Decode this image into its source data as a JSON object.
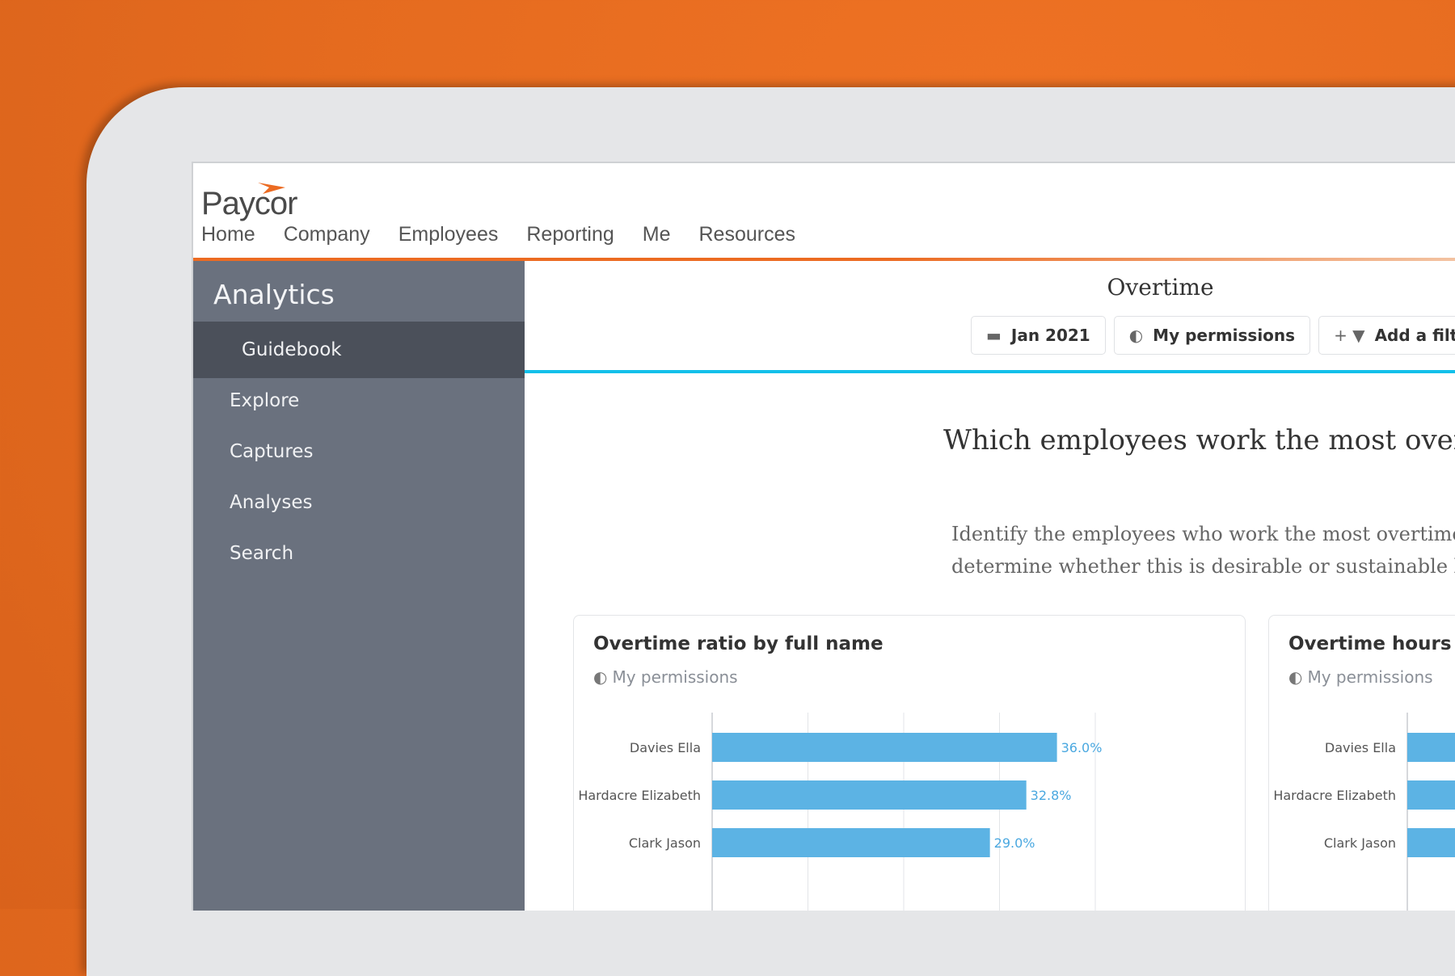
{
  "brand": {
    "logo_text": "Paycor"
  },
  "topnav": {
    "items": [
      "Home",
      "Company",
      "Employees",
      "Reporting",
      "Me",
      "Resources"
    ]
  },
  "sidebar": {
    "title": "Analytics",
    "items": [
      {
        "label": "Guidebook",
        "active": true
      },
      {
        "label": "Explore"
      },
      {
        "label": "Captures"
      },
      {
        "label": "Analyses"
      },
      {
        "label": "Search"
      }
    ]
  },
  "main": {
    "title": "Overtime",
    "filters": {
      "date": "Jan 2021",
      "permissions": "My permissions",
      "add_filter": "Add a filte"
    },
    "question": "Which employees work the most overtin",
    "description": [
      "Identify the employees who work the most overtime",
      "determine whether this is desirable or sustainable be"
    ]
  },
  "cards": [
    {
      "title": "Overtime ratio by full name",
      "permissions": "My permissions"
    },
    {
      "title": "Overtime hours re",
      "permissions": "My permissions"
    }
  ],
  "colors": {
    "accent_orange": "#ec6b22",
    "accent_blue": "#12c0ea",
    "bar": "#5cb3e4",
    "sidebar": "#6a717e",
    "sidebar_active": "#4b505a"
  },
  "chart_data": [
    {
      "type": "bar",
      "orientation": "horizontal",
      "title": "Overtime ratio by full name",
      "categories": [
        "Davies Ella",
        "Hardacre Elizabeth",
        "Clark Jason"
      ],
      "values": [
        36.0,
        32.8,
        29.0
      ],
      "value_labels": [
        "36.0%",
        "32.8%",
        "29.0%"
      ],
      "xlim": [
        0,
        40
      ],
      "grid": true
    },
    {
      "type": "bar",
      "orientation": "horizontal",
      "title": "Overtime hours re",
      "categories": [
        "Davies Ella",
        "Hardacre Elizabeth",
        "Clark Jason"
      ],
      "grid": true
    }
  ]
}
